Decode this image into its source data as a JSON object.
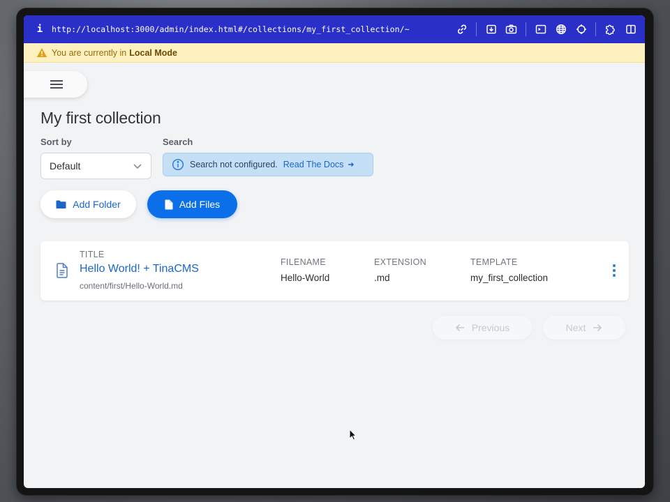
{
  "browser": {
    "info_glyph": "i",
    "url": "http://localhost:3000/admin/index.html#/collections/my_first_collection/~"
  },
  "banner": {
    "prefix": "You are currently in",
    "mode": "Local Mode"
  },
  "page": {
    "title": "My first collection"
  },
  "sort": {
    "label": "Sort by",
    "value": "Default"
  },
  "search": {
    "label": "Search",
    "message": "Search not configured.",
    "link": "Read The Docs"
  },
  "actions": {
    "add_folder": "Add Folder",
    "add_files": "Add Files"
  },
  "table": {
    "headers": {
      "title": "TITLE",
      "filename": "FILENAME",
      "extension": "EXTENSION",
      "template": "TEMPLATE"
    },
    "rows": [
      {
        "title": "Hello World! + TinaCMS",
        "path": "content/first/Hello-World.md",
        "filename": "Hello-World",
        "extension": ".md",
        "template": "my_first_collection"
      }
    ]
  },
  "pagination": {
    "previous": "Previous",
    "next": "Next"
  },
  "colors": {
    "url_bar": "#2a2fc8",
    "banner_bg": "#fdf2bf",
    "primary": "#0a6fe8",
    "link": "#1a67c9"
  }
}
